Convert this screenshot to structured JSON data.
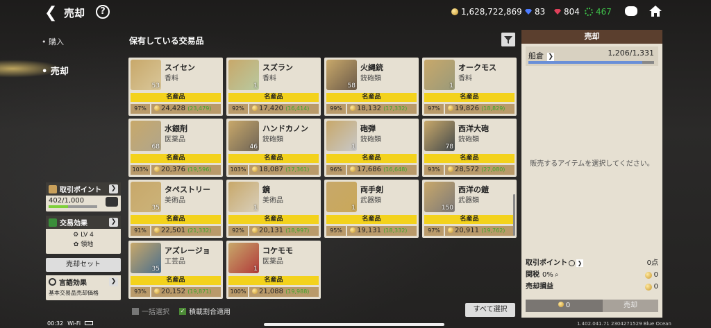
{
  "header": {
    "title": "売却",
    "help": "?"
  },
  "currencies": {
    "gold": "1,628,722,869",
    "blue_gem": "83",
    "red_gem": "804",
    "green": "467"
  },
  "side_menu": {
    "buy": "購入",
    "sell": "売却"
  },
  "trade_points": {
    "label": "取引ポイント",
    "value": "402/1,000",
    "progress": 0.402
  },
  "trade_effect": {
    "label": "交易効果",
    "level": "LV 4",
    "sub": "領地"
  },
  "sell_set": "売却セット",
  "language_effect": {
    "label": "言語効果",
    "desc": "基本交易品売却価格"
  },
  "section_title": "保有している交易品",
  "items": [
    {
      "name": "スイセン",
      "cat": "香料",
      "count": "53",
      "tag": "名産品",
      "pct": "97%",
      "price": "24,428",
      "delta": "(23,479)"
    },
    {
      "name": "スズラン",
      "cat": "香料",
      "count": "1",
      "tag": "名産品",
      "pct": "92%",
      "price": "17,420",
      "delta": "(16,414)"
    },
    {
      "name": "火縄銃",
      "cat": "銃砲類",
      "count": "58",
      "tag": "名産品",
      "pct": "99%",
      "price": "18,132",
      "delta": "(17,332)"
    },
    {
      "name": "オークモス",
      "cat": "香料",
      "count": "1",
      "tag": "名産品",
      "pct": "97%",
      "price": "19,826",
      "delta": "(18,829)"
    },
    {
      "name": "水銀剤",
      "cat": "医薬品",
      "count": "68",
      "tag": "名産品",
      "pct": "103%",
      "price": "20,376",
      "delta": "(19,596)"
    },
    {
      "name": "ハンドカノン",
      "cat": "銃砲類",
      "count": "46",
      "tag": "名産品",
      "pct": "103%",
      "price": "18,087",
      "delta": "(17,361)"
    },
    {
      "name": "砲弾",
      "cat": "銃砲類",
      "count": "1",
      "tag": "名産品",
      "pct": "96%",
      "price": "17,686",
      "delta": "(16,648)"
    },
    {
      "name": "西洋大砲",
      "cat": "銃砲類",
      "count": "78",
      "tag": "名産品",
      "pct": "93%",
      "price": "28,572",
      "delta": "(27,080)"
    },
    {
      "name": "タペストリー",
      "cat": "美術品",
      "count": "35",
      "tag": "名産品",
      "pct": "91%",
      "price": "22,501",
      "delta": "(21,332)"
    },
    {
      "name": "鏡",
      "cat": "美術品",
      "count": "1",
      "tag": "名産品",
      "pct": "92%",
      "price": "20,131",
      "delta": "(18,997)"
    },
    {
      "name": "両手剣",
      "cat": "武器類",
      "count": "1",
      "tag": "名産品",
      "pct": "95%",
      "price": "19,131",
      "delta": "(18,332)"
    },
    {
      "name": "西洋の鎧",
      "cat": "武器類",
      "count": "150",
      "tag": "名産品",
      "pct": "97%",
      "price": "20,911",
      "delta": "(19,762)"
    },
    {
      "name": "アズレージョ",
      "cat": "工芸品",
      "count": "35",
      "tag": "名産品",
      "pct": "93%",
      "price": "20,152",
      "delta": "(19,871)"
    },
    {
      "name": "コケモモ",
      "cat": "医薬品",
      "count": "1",
      "tag": "名産品",
      "pct": "100%",
      "price": "21,088",
      "delta": "(19,988)"
    }
  ],
  "right_panel": {
    "title": "売却",
    "warehouse_label": "船倉",
    "warehouse_value": "1,206/1,331",
    "warehouse_fill": 0.906,
    "empty_msg": "販売するアイテムを選択してください。",
    "trade_points_label": "取引ポイント",
    "trade_points_value": "0点",
    "tax_label": "関税",
    "tax_value": "0%",
    "tax_amount": "0",
    "profit_label": "売却損益",
    "profit_value": "0",
    "total": "0",
    "sell_btn": "売却"
  },
  "bottom": {
    "bulk_select": "一括選択",
    "load_ratio": "積載割合適用",
    "select_all": "すべて選択",
    "time": "00:32",
    "wifi": "Wi-Fi",
    "version": "1.402.041.71 2304271529 Blue Ocean"
  }
}
